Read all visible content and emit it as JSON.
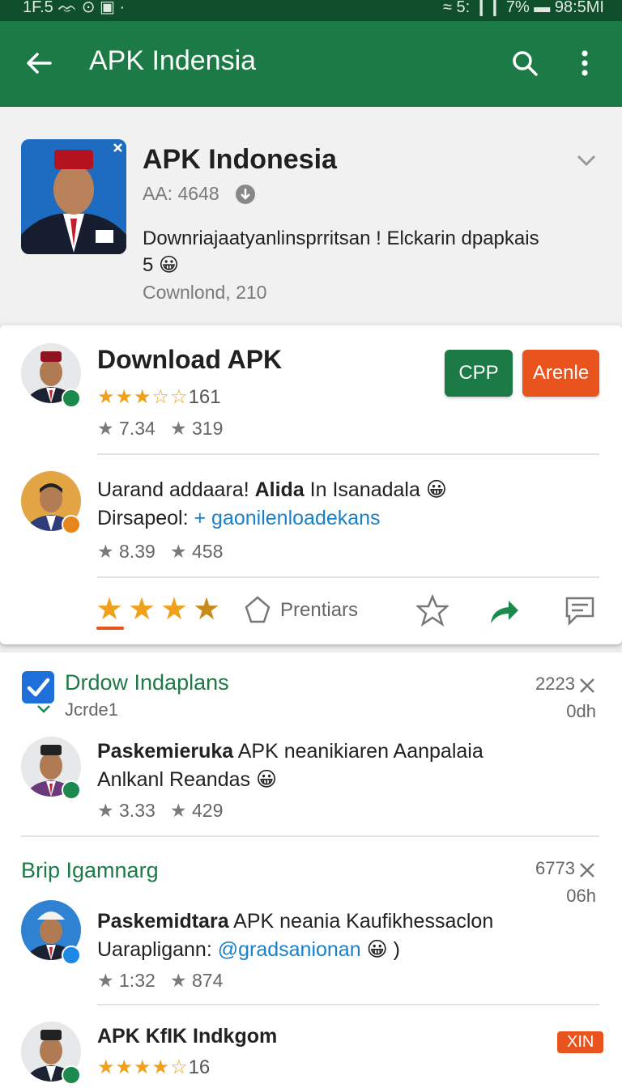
{
  "status_bar": {
    "left": "1F.5 ᨎ ⊙ ▣ ·",
    "right": "≈ 5: ❙❙ 7% ▬ 98:5MI"
  },
  "app_bar": {
    "title": "APK Indensia",
    "icons": [
      "back-arrow-icon",
      "search-icon",
      "more-vert-icon"
    ]
  },
  "header": {
    "app_name": "APK Indonesia",
    "meta": "AA: 4648",
    "description_line1": "Downriajaatyanlinsprritsan ! Elckarin dpapkais",
    "description_line2": "5 😀",
    "downloads": "Cownlond, 210"
  },
  "card": {
    "title": "Download APK",
    "stars_text": "★★★☆☆",
    "stars_count": "161",
    "stat_a": "7.34",
    "stat_b": "319",
    "btn_primary": "CPP",
    "btn_secondary": "Arenle",
    "post_line1_a": "Uarand addaara! ",
    "post_line1_b": "Alida",
    "post_line1_c": " In Isanadala 😀",
    "post_line2_a": "Dirsapeol: ",
    "post_line2_link": "+ gaonilenloadekans",
    "post_stat_a": "8.39",
    "post_stat_b": "458",
    "rate_label": "Prentiars"
  },
  "feed": {
    "section1": {
      "title": "Drdow Indaplans",
      "subtitle": "Jcrde1",
      "count": "2223",
      "time": "0dh"
    },
    "item1": {
      "title": "Paskemieruka",
      "title_rest": " APK neanikiaren Aanpalaia",
      "line2": "Anlkanl Reandas 😀",
      "stat_a": "3.33",
      "stat_b": "429"
    },
    "section2": {
      "title": "Brip Igamnarg",
      "count": "6773",
      "time": "06h"
    },
    "item2": {
      "title": "Paskemidtara",
      "title_rest": " APK neania Kaufikhessaclon",
      "line2_a": "Uarapligann: ",
      "line2_link": "@gradsanionan",
      "line2_b": " 😀 )",
      "stat_a": "1:32",
      "stat_b": "874"
    },
    "item3": {
      "title": "APK KfIK Indkgom",
      "stars_text": "★★★★☆",
      "stars_count": "16",
      "tag": "XIN"
    }
  },
  "colors": {
    "brand": "#1b7a45",
    "accent_orange": "#e8531e",
    "star": "#f0a01a",
    "link": "#1a80c8"
  }
}
